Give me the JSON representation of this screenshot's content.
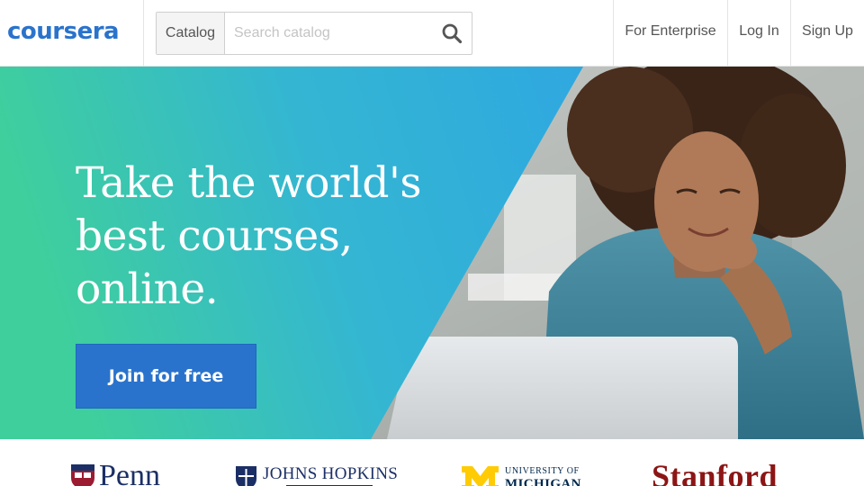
{
  "header": {
    "logo": "coursera",
    "catalog_label": "Catalog",
    "search_placeholder": "Search catalog",
    "search_value": "",
    "nav": {
      "enterprise": "For Enterprise",
      "login": "Log In",
      "signup": "Sign Up"
    }
  },
  "hero": {
    "title": "Take the world's best courses, online.",
    "cta_label": "Join for free",
    "image_subject": "woman-smiling-at-laptop"
  },
  "partners": [
    {
      "name": "Penn"
    },
    {
      "name": "JOHNS HOPKINS"
    },
    {
      "name_top": "UNIVERSITY OF",
      "name_bottom": "MICHIGAN"
    },
    {
      "name": "Stanford"
    }
  ],
  "icons": {
    "search": "search-icon",
    "penn_shield": "penn-shield-icon",
    "jhu_shield": "jhu-shield-icon",
    "michigan_block_m": "block-m-icon"
  },
  "colors": {
    "brand_blue": "#2a73cc",
    "hero_green": "#3fcf9c",
    "hero_blue": "#2fa8e0",
    "penn_navy": "#1b2f66",
    "michigan_maize": "#ffcb05",
    "michigan_blue": "#00274c",
    "stanford_cardinal": "#8c1515"
  }
}
